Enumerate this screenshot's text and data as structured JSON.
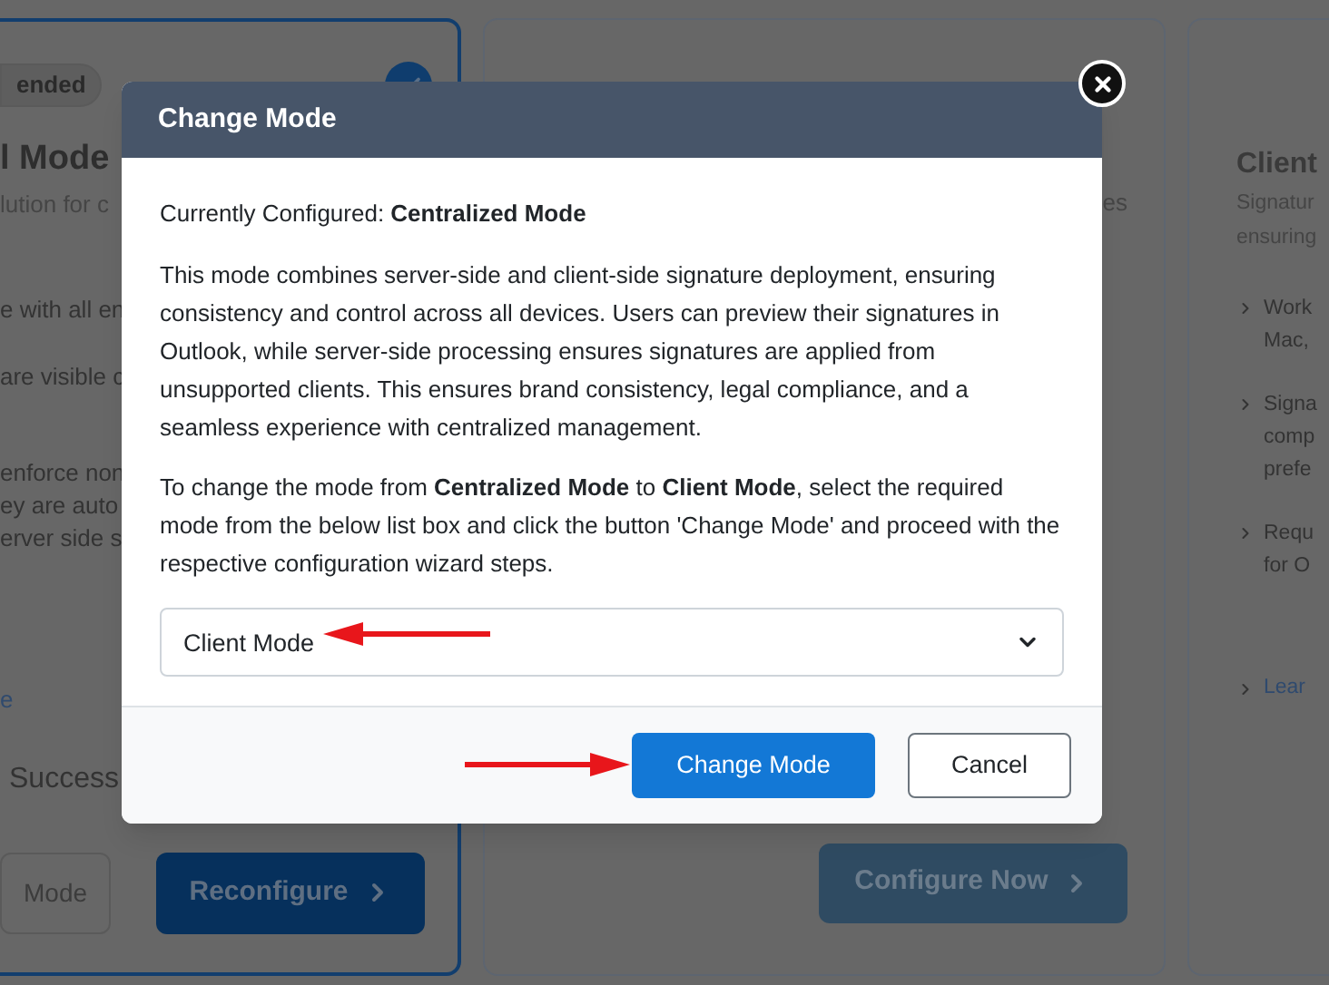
{
  "left_card": {
    "badge": "ended",
    "checked": true,
    "title": "l Mode",
    "subtitle": "lution for c",
    "features": [
      {
        "lines": [
          "e with all en"
        ]
      },
      {
        "lines": [
          "are visible c"
        ]
      },
      {
        "lines": [
          "enforce non",
          "ey are auto",
          "erver side s"
        ]
      }
    ],
    "link": "e",
    "status": "Success",
    "buttons": [
      {
        "label": "Mode",
        "kind": "outline"
      },
      {
        "label": "Reconfigure",
        "kind": "primary"
      }
    ]
  },
  "middle_card": {
    "subtitle": "es",
    "button": "Configure Now"
  },
  "right_card": {
    "title": "Client",
    "subtitle_lines": [
      "Signatur",
      "ensuring"
    ],
    "features": [
      {
        "lines": [
          "Work",
          "Mac,"
        ]
      },
      {
        "lines": [
          "Signa",
          "comp",
          "prefe"
        ]
      },
      {
        "lines": [
          "Requ",
          "for O"
        ]
      }
    ],
    "link": "Lear"
  },
  "dialog": {
    "title": "Change Mode",
    "current": "Currently Configured: **Centralized Mode**",
    "description": "This mode combines server-side and client-side signature deployment, ensuring consistency and control across all devices. Users can preview their signatures in Outlook, while server-side processing ensures signatures are applied from unsupported clients. This ensures brand consistency, legal compliance, and a seamless experience with centralized management.",
    "instructions": "To change the mode from **Centralized Mode** to **Client Mode**, select the required mode from the below list box and click the button 'Change Mode' and proceed with the respective configuration wizard steps.",
    "select_value": "Client Mode",
    "buttons": [
      {
        "label": "Change Mode",
        "kind": "primary"
      },
      {
        "label": "Cancel",
        "kind": "outline"
      }
    ]
  }
}
